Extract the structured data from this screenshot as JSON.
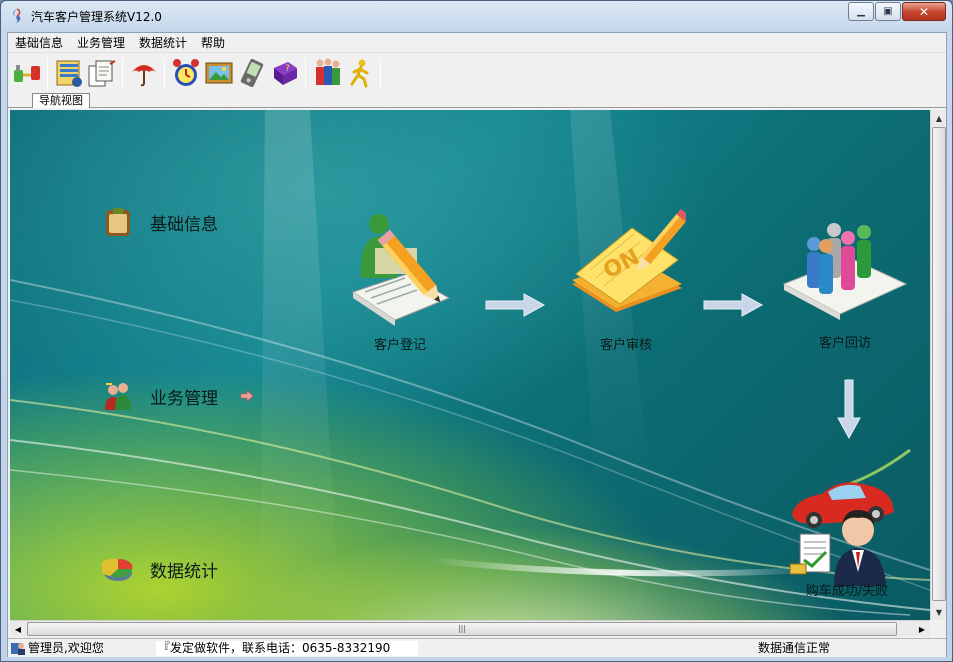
{
  "window": {
    "title": "汽车客户管理系统V12.0",
    "controls": {
      "minimize_icon": "minimize-icon",
      "maximize_icon": "maximize-icon",
      "close_icon": "close-icon"
    }
  },
  "menu": [
    "基础信息",
    "业务管理",
    "数据统计",
    "帮助"
  ],
  "toolbar": [
    {
      "icon": "connect-icon"
    },
    {
      "icon": "folder-icon"
    },
    {
      "icon": "documents-icon"
    },
    {
      "icon": "umbrella-icon"
    },
    {
      "icon": "alarm-clock-icon"
    },
    {
      "icon": "picture-frame-icon"
    },
    {
      "icon": "handheld-device-icon"
    },
    {
      "icon": "help-book-icon"
    },
    {
      "icon": "users-icon"
    },
    {
      "icon": "running-man-icon"
    }
  ],
  "tab": {
    "label": "导航视图"
  },
  "nav": {
    "items": [
      {
        "label": "基础信息",
        "icon": "clipboard-icon"
      },
      {
        "label": "业务管理",
        "icon": "people-icon",
        "arrow": "arrow-right-icon"
      },
      {
        "label": "数据统计",
        "icon": "pie-chart-icon"
      }
    ]
  },
  "flow": {
    "nodes": [
      {
        "label": "客户登记",
        "icon": "register-icon"
      },
      {
        "label": "客户审核",
        "icon": "review-icon"
      },
      {
        "label": "客户回访",
        "icon": "visit-icon"
      },
      {
        "label": "购车成功/失败",
        "icon": "car-buyer-icon"
      }
    ],
    "arrow_color": "#c8d6e8"
  },
  "status": {
    "user": "管理员,欢迎您",
    "contact": "『发定做软件，联系电话：0635-8332190",
    "comm": "数据通信正常"
  },
  "colors": {
    "canvas_teal": "#13848f",
    "canvas_green": "#bedc28",
    "close_button": "#c7442e"
  }
}
